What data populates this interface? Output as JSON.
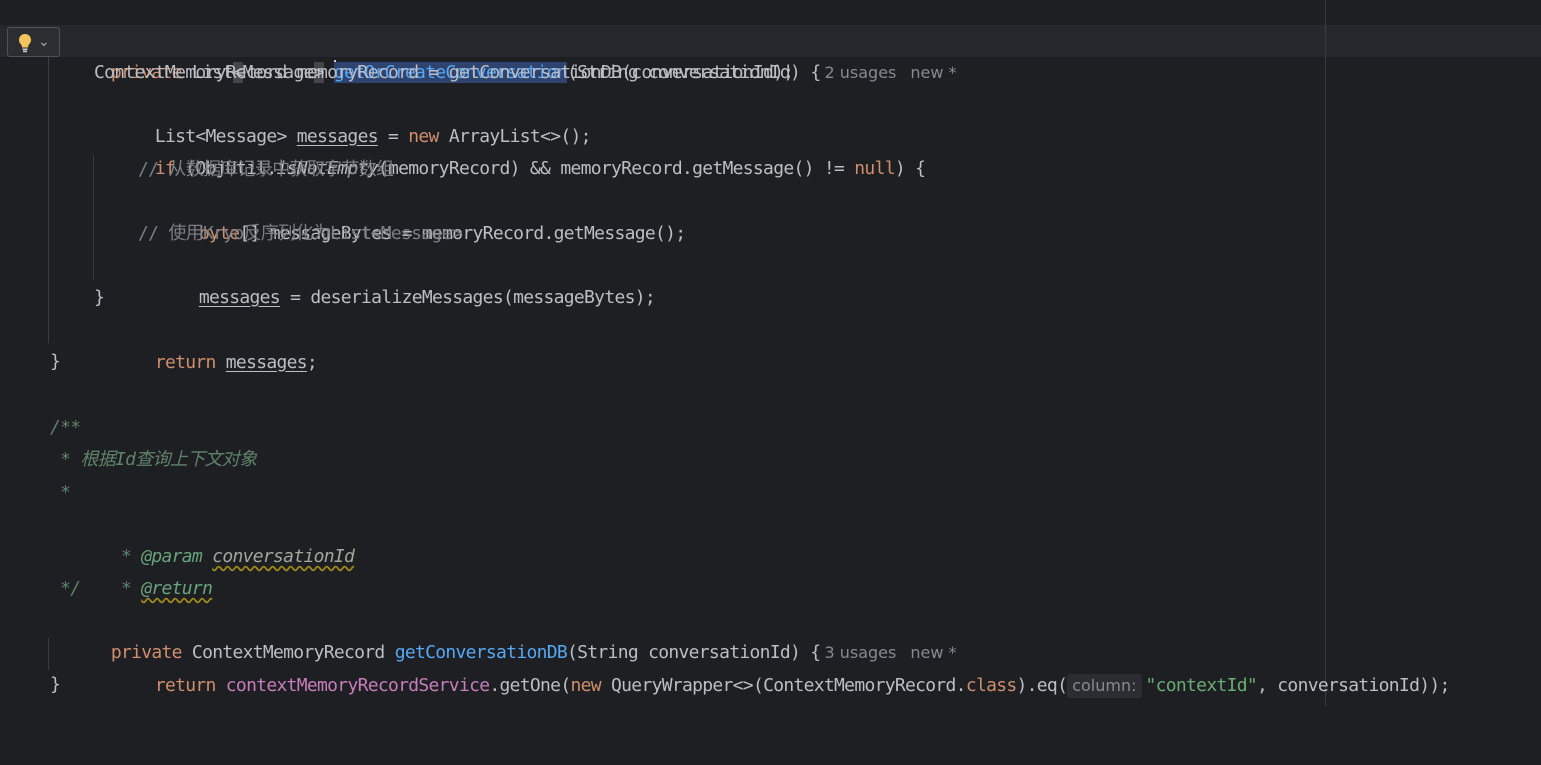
{
  "editor": {
    "usage_hints": {
      "get_or_create": "2 usages",
      "get_conversation_db": "3 usages",
      "new_marker": "new *"
    },
    "inlay_hint": "column:",
    "icons": {
      "intention_action": "lightbulb-icon",
      "intention_menu": "chevron-down-icon"
    },
    "colors": {
      "background": "#1e1f22",
      "keyword": "#cf8e6d",
      "function": "#56a8f5",
      "comment": "#7a7e85",
      "doc_comment": "#5f826b",
      "field": "#c77dbb",
      "string": "#6aab73",
      "caret_line": "#26282e"
    },
    "lines": {
      "l1": {
        "kw_private": "private",
        "type_list": "List",
        "lt": "<",
        "type_message": "Message",
        "gt": ">",
        "method": "getOrCreateConversation",
        "params": "(String conversationId) {"
      },
      "l2": {
        "text": "ContextMemoryRecord memoryRecord = getConversationDB(conversationId);"
      },
      "l3": {
        "decl": "List<Message> ",
        "var": "messages",
        "eq": " = ",
        "kw_new": "new",
        "rest": " ArrayList<>();"
      },
      "l4": {
        "kw_if": "if",
        "open": " (ObjUtil.",
        "static_call": "isNotEmpty",
        "mid": "(memoryRecord) && memoryRecord.getMessage() != ",
        "kw_null": "null",
        "close": ") {"
      },
      "l5": {
        "comment": "// 从数据库记录中获取字节数组"
      },
      "l6": {
        "kw_byte": "byte",
        "rest": "[] messageBytes = memoryRecord.getMessage();"
      },
      "l7": {
        "comment": "// 使用Kryo反序列化为List<Message>"
      },
      "l8": {
        "var": "messages",
        "rest": " = deserializeMessages(messageBytes);"
      },
      "l9": {
        "text": "}"
      },
      "l10": {
        "kw_return": "return",
        "space": " ",
        "var": "messages",
        "semi": ";"
      },
      "l11": {
        "text": "}"
      },
      "l12": {
        "text": "/**"
      },
      "l13": {
        "text": " * 根据Id查询上下文对象"
      },
      "l14": {
        "text": " *"
      },
      "l15": {
        "prefix": " * ",
        "tag": "@param",
        "space": " ",
        "param": "conversationId"
      },
      "l16": {
        "prefix": " * ",
        "tag": "@return"
      },
      "l17": {
        "text": " */"
      },
      "l18": {
        "kw_private": "private",
        "type": " ContextMemoryRecord ",
        "method": "getConversationDB",
        "params": "(String conversationId) {"
      },
      "l19": {
        "kw_return": "return",
        "space": " ",
        "field": "contextMemoryRecordService",
        "call": ".getOne(",
        "kw_new": "new",
        "wrapper": " QueryWrapper<>(ContextMemoryRecord.",
        "kw_class": "class",
        "eq": ").eq(",
        "str": "\"contextId\"",
        "rest": ", conversationId));"
      },
      "l20": {
        "text": "}"
      }
    }
  }
}
